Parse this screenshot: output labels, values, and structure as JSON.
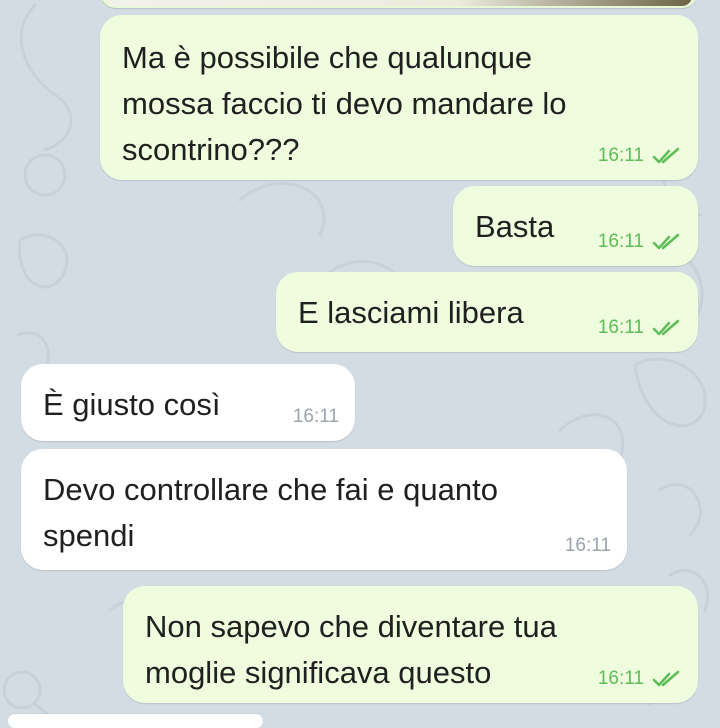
{
  "chat": {
    "messages": [
      {
        "direction": "outgoing",
        "text": "Ma è possibile che qualunque\nmossa faccio ti devo mandare lo\nscontrino???",
        "time": "16:11",
        "status": "read"
      },
      {
        "direction": "outgoing",
        "text": "Basta",
        "time": "16:11",
        "status": "read"
      },
      {
        "direction": "outgoing",
        "text": "E lasciami libera",
        "time": "16:11",
        "status": "read"
      },
      {
        "direction": "incoming",
        "text": "È giusto così",
        "time": "16:11"
      },
      {
        "direction": "incoming",
        "text": "Devo controllare che fai e quanto\nspendi",
        "time": "16:11"
      },
      {
        "direction": "outgoing",
        "text": "Non sapevo che diventare tua\nmoglie significava questo",
        "time": "16:11",
        "status": "read"
      }
    ]
  },
  "theme": {
    "background": "#d3dbe3",
    "outgoing_bubble": "#effdde",
    "incoming_bubble": "#ffffff",
    "read_check_color": "#5ebd59",
    "incoming_time_color": "#9ca3ad"
  },
  "icons": {
    "read_receipt": "double-check-icon"
  }
}
